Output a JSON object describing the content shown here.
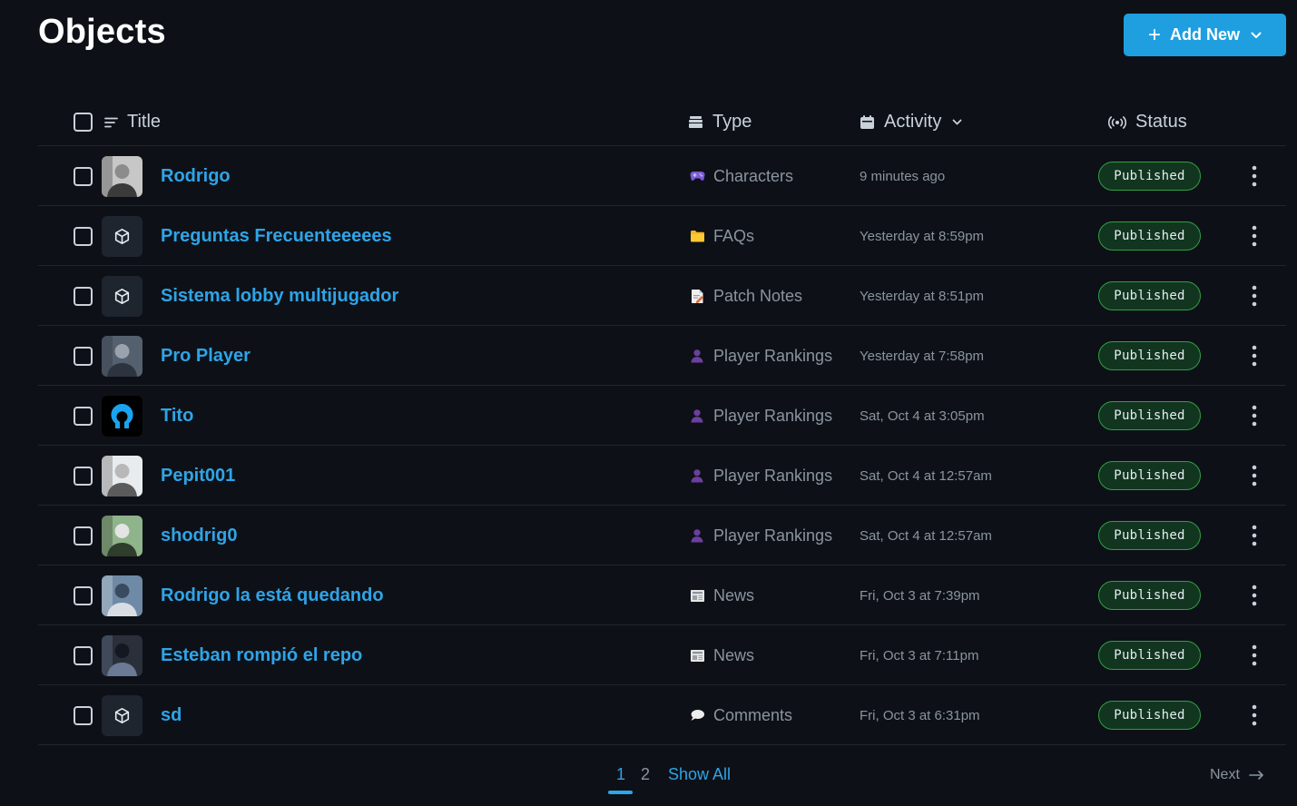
{
  "header": {
    "title": "Objects",
    "add_button": {
      "plus": "+",
      "label": "Add New"
    }
  },
  "columns": {
    "title": "Title",
    "type": "Type",
    "activity": "Activity",
    "status": "Status"
  },
  "rows": [
    {
      "title": "Rodrigo",
      "thumb": "photo",
      "type_icon": "gamepad-icon",
      "type": "Characters",
      "activity": "9 minutes ago",
      "status": "Published"
    },
    {
      "title": "Preguntas Frecuenteeeees",
      "thumb": "cube",
      "type_icon": "folder-icon",
      "type": "FAQs",
      "activity": "Yesterday at 8:59pm",
      "status": "Published"
    },
    {
      "title": "Sistema lobby multijugador",
      "thumb": "cube",
      "type_icon": "memo-icon",
      "type": "Patch Notes",
      "activity": "Yesterday at 8:51pm",
      "status": "Published"
    },
    {
      "title": "Pro Player",
      "thumb": "photo",
      "type_icon": "person-icon",
      "type": "Player Rankings",
      "activity": "Yesterday at 7:58pm",
      "status": "Published"
    },
    {
      "title": "Tito",
      "thumb": "logo",
      "type_icon": "person-icon",
      "type": "Player Rankings",
      "activity": "Sat, Oct 4 at 3:05pm",
      "status": "Published"
    },
    {
      "title": "Pepit001",
      "thumb": "photo",
      "type_icon": "person-icon",
      "type": "Player Rankings",
      "activity": "Sat, Oct 4 at 12:57am",
      "status": "Published"
    },
    {
      "title": "shodrig0",
      "thumb": "photo",
      "type_icon": "person-icon",
      "type": "Player Rankings",
      "activity": "Sat, Oct 4 at 12:57am",
      "status": "Published"
    },
    {
      "title": "Rodrigo la está quedando",
      "thumb": "photo",
      "type_icon": "newspaper-icon",
      "type": "News",
      "activity": "Fri, Oct 3 at 7:39pm",
      "status": "Published"
    },
    {
      "title": "Esteban rompió el repo",
      "thumb": "photo",
      "type_icon": "newspaper-icon",
      "type": "News",
      "activity": "Fri, Oct 3 at 7:11pm",
      "status": "Published"
    },
    {
      "title": "sd",
      "thumb": "cube",
      "type_icon": "speech-bubble-icon",
      "type": "Comments",
      "activity": "Fri, Oct 3 at 6:31pm",
      "status": "Published"
    }
  ],
  "pagination": {
    "current": "1",
    "page2": "2",
    "show_all": "Show All",
    "next": "Next"
  },
  "colors": {
    "background": "#0d1117",
    "accent": "#1f9fe0",
    "link": "#2fa4e7",
    "badge_border": "#2ea043",
    "badge_bg": "#12351f"
  }
}
